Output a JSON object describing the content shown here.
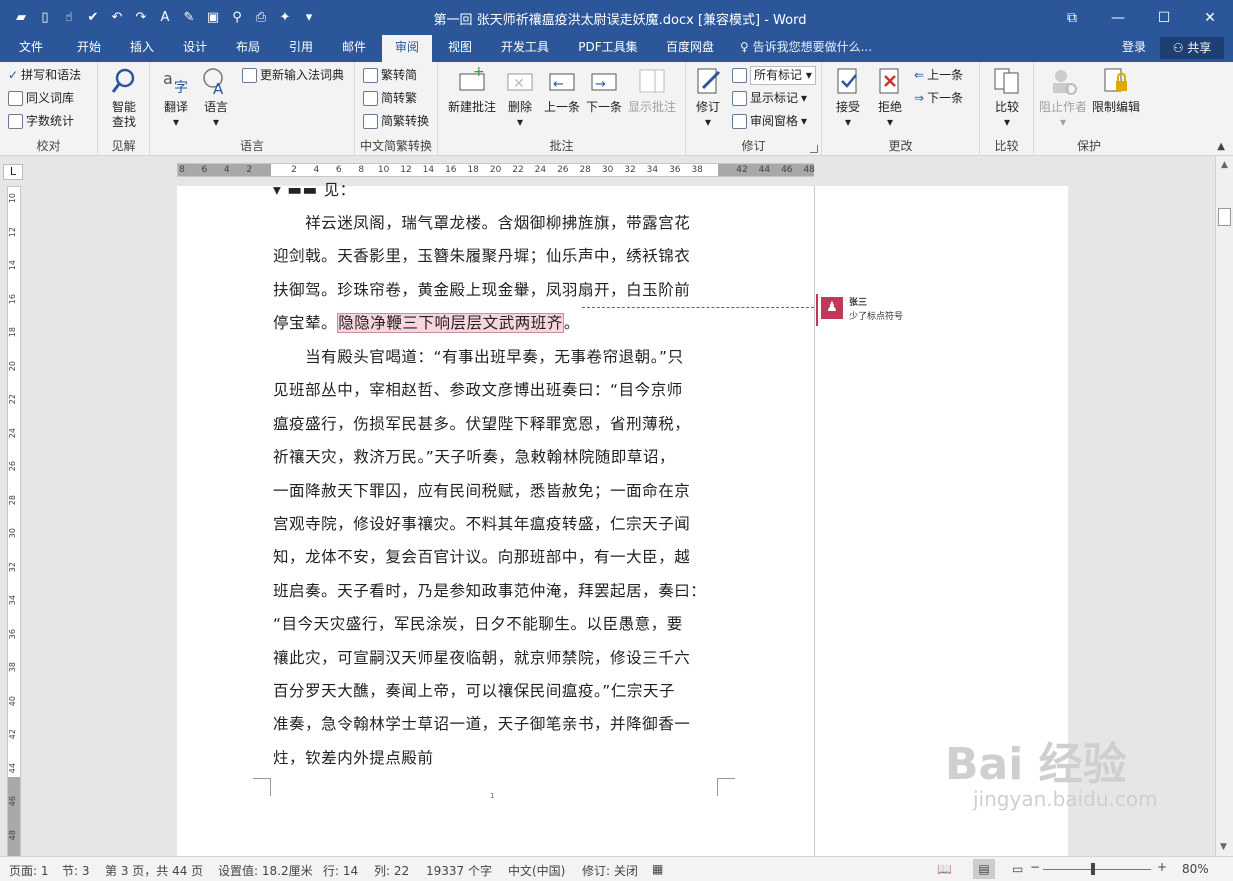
{
  "window": {
    "title": "第一回 张天师祈禳瘟疫洪太尉误走妖魔.docx [兼容模式] - Word",
    "controls": {
      "restore": "⧉",
      "minimize": "—",
      "maximize": "☐",
      "close": "✕"
    }
  },
  "tabs": [
    "文件",
    "开始",
    "插入",
    "设计",
    "布局",
    "引用",
    "邮件",
    "审阅",
    "视图",
    "开发工具",
    "PDF工具集",
    "百度网盘"
  ],
  "active_tab": "审阅",
  "tell_me": "告诉我您想要做什么...",
  "login": "登录",
  "share": "共享",
  "ribbon": {
    "proofing": {
      "spell": "拼写和语法",
      "thesaurus": "同义词库",
      "wordcount": "字数统计",
      "label": "校对"
    },
    "insights": {
      "smart": "智能\n查找",
      "label": "见解"
    },
    "language": {
      "translate": "翻译",
      "language": "语言",
      "ime": "更新输入法词典",
      "label": "语言"
    },
    "chinese": {
      "t2s": "繁转简",
      "s2t": "简转繁",
      "convert": "简繁转换",
      "label": "中文简繁转换"
    },
    "comments": {
      "new": "新建批注",
      "delete": "删除",
      "prev": "上一条",
      "next": "下一条",
      "show": "显示批注",
      "label": "批注"
    },
    "tracking": {
      "track": "修订",
      "markup_select": "所有标记",
      "show_markup": "显示标记",
      "pane": "审阅窗格",
      "label": "修订"
    },
    "changes": {
      "accept": "接受",
      "reject": "拒绝",
      "prev": "上一条",
      "next": "下一条",
      "label": "更改"
    },
    "compare": {
      "compare": "比较",
      "label": "比较"
    },
    "protect": {
      "block": "阻止作者",
      "restrict": "限制编辑",
      "label": "保护"
    }
  },
  "ruler": {
    "ticks": [
      "8",
      "6",
      "4",
      "2",
      "",
      "2",
      "4",
      "6",
      "8",
      "10",
      "12",
      "14",
      "16",
      "18",
      "20",
      "22",
      "24",
      "26",
      "28",
      "30",
      "32",
      "34",
      "36",
      "38",
      "",
      "42",
      "44",
      "46",
      "48"
    ],
    "vticks": [
      "10",
      "12",
      "14",
      "16",
      "18",
      "20",
      "22",
      "24",
      "26",
      "28",
      "30",
      "32",
      "34",
      "36",
      "38",
      "40",
      "42",
      "44",
      "46",
      "48"
    ]
  },
  "document": {
    "top_fragment": "见：",
    "paragraphs": [
      {
        "lines": [
          "　　祥云迷凤阁，瑞气罩龙楼。含烟御柳拂旌旗，带露宫花",
          "迎剑戟。天香影里，玉簪朱履聚丹墀；仙乐声中，绣袄锦衣",
          "扶御驾。珍珠帘卷，黄金殿上现金轝，凤羽扇开，白玉阶前"
        ],
        "last_before": "停宝辇。",
        "highlight": "隐隐净鞭三下响层层文武两班齐",
        "last_after": "。"
      },
      {
        "lines": [
          "　　当有殿头官喝道：“有事出班早奏，无事卷帘退朝。”只",
          "见班部丛中，宰相赵哲、参政文彦博出班奏曰：“目今京师",
          "瘟疫盛行，伤损军民甚多。伏望陛下释罪宽恩，省刑薄税，",
          "祈禳天灾，救济万民。”天子听奏，急敕翰林院随即草诏，",
          "一面降赦天下罪囚，应有民间税赋，悉皆赦免；一面命在京",
          "宫观寺院，修设好事禳灾。不料其年瘟疫转盛，仁宗天子闻",
          "知，龙体不安，复会百官计议。向那班部中，有一大臣，越",
          "班启奏。天子看时，乃是参知政事范仲淹，拜罢起居，奏曰：",
          "“目今天灾盛行，军民涂炭，日夕不能聊生。以臣愚意，要",
          "禳此灾，可宣嗣汉天师星夜临朝，就京师禁院，修设三千六",
          "百分罗天大醮，奏闻上帝，可以禳保民间瘟疫。”仁宗天子",
          "准奏，急令翰林学士草诏一道，天子御笔亲书，并降御香一",
          "炷，钦差内外提点殿前"
        ]
      }
    ],
    "page_number": "1"
  },
  "comment": {
    "author": "张三",
    "text": "少了标点符号",
    "avatar_icon": "person-icon"
  },
  "status": {
    "page": "页面: 1",
    "section": "节: 3",
    "page_of": "第 3 页，共 44 页",
    "position": "设置值: 18.2厘米",
    "line": "行: 14",
    "column": "列: 22",
    "chars": "19337 个字",
    "lang": "中文(中国)",
    "track": "修订: 关闭",
    "zoom": "80%"
  },
  "watermark": {
    "brand": "Bai 经验",
    "url": "jingyan.baidu.com"
  },
  "colors": {
    "accent": "#2b579a",
    "comment": "#c0395a",
    "highlight": "#f9d6de"
  }
}
